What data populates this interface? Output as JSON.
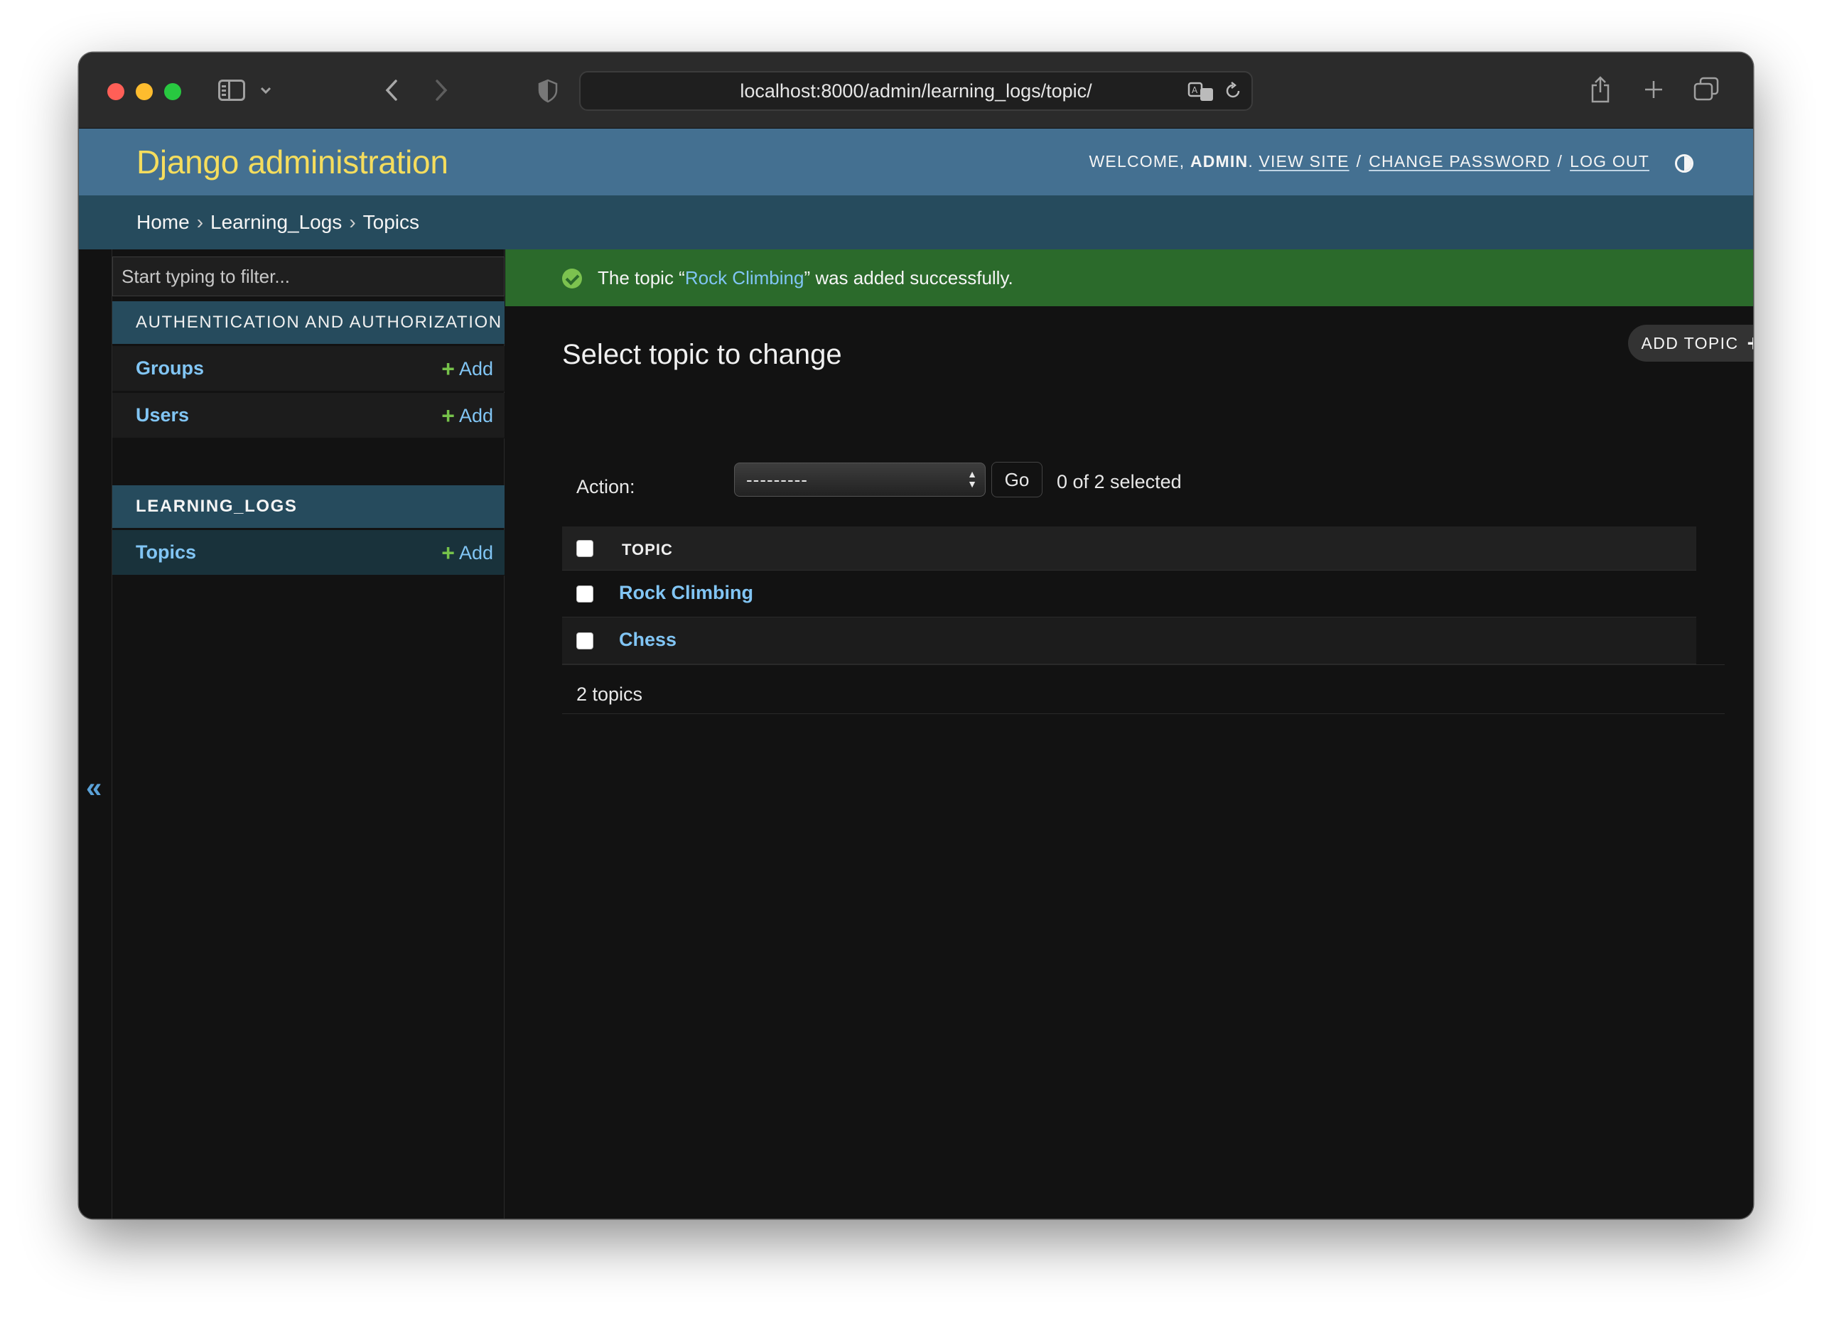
{
  "browser": {
    "url": "localhost:8000/admin/learning_logs/topic/"
  },
  "header": {
    "brand": "Django administration",
    "welcome": "WELCOME,",
    "username": "ADMIN",
    "period": ".",
    "view_site": "VIEW SITE",
    "change_password": "CHANGE PASSWORD",
    "log_out": "LOG OUT",
    "sep": "/"
  },
  "breadcrumbs": {
    "home": "Home",
    "app": "Learning_Logs",
    "current": "Topics",
    "sep": "›"
  },
  "sidebar": {
    "filter_placeholder": "Start typing to filter...",
    "collapse_glyph": "«",
    "add_label": "Add",
    "apps": [
      {
        "caption": "AUTHENTICATION AND AUTHORIZATION",
        "models": [
          "Groups",
          "Users"
        ]
      },
      {
        "caption": "LEARNING_LOGS",
        "models": [
          "Topics"
        ]
      }
    ]
  },
  "message": {
    "prefix": "The topic “",
    "object": "Rock Climbing",
    "suffix": "” was added successfully."
  },
  "content": {
    "title": "Select topic to change",
    "add_button": "ADD TOPIC",
    "action_label": "Action:",
    "action_value": "---------",
    "go_label": "Go",
    "selected_count": "0 of 2 selected",
    "column_header": "TOPIC",
    "rows": [
      "Rock Climbing",
      "Chess"
    ],
    "paginator": "2 topics"
  },
  "colors": {
    "header_bg": "#447091",
    "brand": "#f5dd5d",
    "breadcrumb_bg": "#264b5d",
    "link": "#81c5f4",
    "success_bg": "#2b6a2b",
    "add_plus": "#76c24a",
    "page_bg": "#121212"
  }
}
